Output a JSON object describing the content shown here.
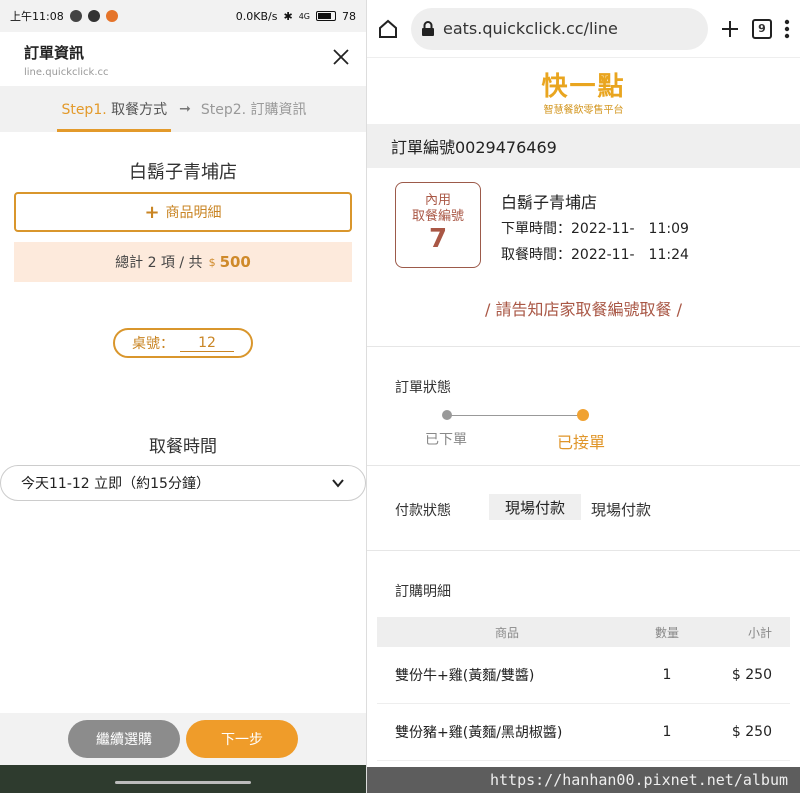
{
  "left": {
    "status_bar": {
      "time": "上午11:08",
      "speed": "0.0KB/s",
      "network": "4G",
      "battery": "78"
    },
    "header": {
      "title": "訂單資訊",
      "subtitle": "line.quickclick.cc"
    },
    "steps": {
      "step1_prefix": "Step1.",
      "step1_name": "取餐方式",
      "arrow": "➞",
      "step2": "Step2. 訂購資訊"
    },
    "store_name": "白鬍子青埔店",
    "items_button": {
      "plus": "+",
      "label": "商品明細"
    },
    "total": {
      "label": "總計 2 項 / 共",
      "currency": "$",
      "amount": "500"
    },
    "table_number": {
      "label": "桌號：",
      "value": "12"
    },
    "pickup": {
      "label": "取餐時間",
      "selected": "今天11-12 立即（約15分鐘）"
    },
    "buttons": {
      "continue": "繼續選購",
      "next": "下一步"
    }
  },
  "right": {
    "browser": {
      "url": "eats.quickclick.cc/line",
      "tab_count": "9"
    },
    "logo": {
      "name": "快一點",
      "tagline": "智慧餐飲零售平台"
    },
    "order_number": "訂單編號0029476469",
    "ticket": {
      "line1": "內用",
      "line2": "取餐編號",
      "number": "7"
    },
    "store_name": "白鬍子青埔店",
    "order_time": "下單時間：2022-11-　11:09",
    "pickup_time": "取餐時間：2022-11-　11:24",
    "notice": "/ 請告知店家取餐編號取餐 /",
    "status": {
      "label": "訂單狀態",
      "step1": "已下單",
      "step2": "已接單"
    },
    "payment": {
      "label": "付款狀態",
      "chip": "現場付款",
      "text": "現場付款"
    },
    "details": {
      "label": "訂購明細",
      "headers": [
        "商品",
        "數量",
        "小計"
      ],
      "rows": [
        {
          "name": "雙份牛+雞(黃麵/雙醬)",
          "qty": "1",
          "subtotal": "$ 250"
        },
        {
          "name": "雙份豬+雞(黃麵/黑胡椒醬)",
          "qty": "1",
          "subtotal": "$ 250"
        }
      ]
    },
    "watermark": "https://hanhan00.pixnet.net/album"
  },
  "colors": {
    "accent": "#e39a2b",
    "brown": "#a95745",
    "next_button": "#ef9c2a"
  }
}
